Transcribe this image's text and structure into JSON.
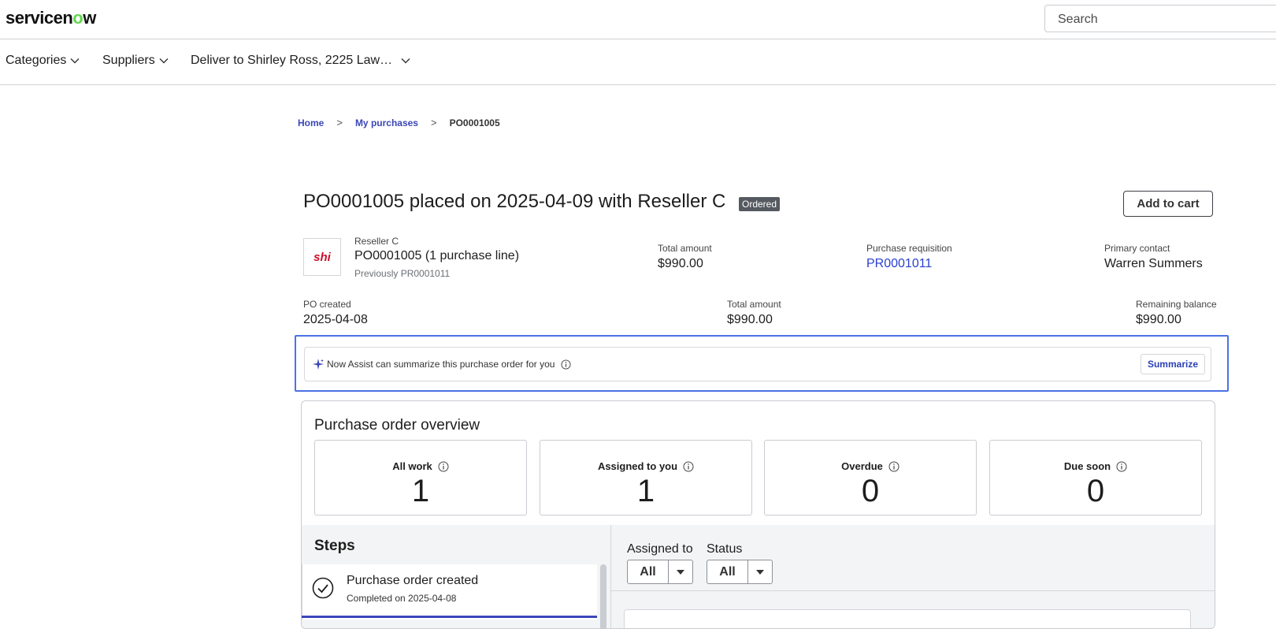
{
  "header": {
    "logo_pre": "servicen",
    "logo_o": "o",
    "logo_post": "w",
    "search_placeholder": "Search"
  },
  "nav": {
    "categories": "Categories",
    "suppliers": "Suppliers",
    "deliver_to": "Deliver to Shirley Ross, 2225 Law…"
  },
  "breadcrumb": {
    "home": "Home",
    "my_purchases": "My purchases",
    "current": "PO0001005"
  },
  "order": {
    "title": "PO0001005 placed on 2025-04-09 with Reseller C",
    "status_badge": "Ordered",
    "add_to_cart": "Add to cart",
    "supplier_logo_text": "shi",
    "supplier_name": "Reseller C",
    "po_line": "PO0001005 (1 purchase line)",
    "previously": "Previously PR0001011",
    "total_amount_label_1": "Total amount",
    "total_amount_value_1": "$990.00",
    "purchase_requisition_label": "Purchase requisition",
    "purchase_requisition_value": "PR0001011",
    "primary_contact_label": "Primary contact",
    "primary_contact_value": "Warren Summers",
    "po_created_label": "PO created",
    "po_created_value": "2025-04-08",
    "total_amount_label_2": "Total amount",
    "total_amount_value_2": "$990.00",
    "remaining_balance_label": "Remaining balance",
    "remaining_balance_value": "$990.00"
  },
  "assist": {
    "text": "Now Assist can summarize this purchase order for you",
    "button": "Summarize"
  },
  "overview": {
    "title": "Purchase order overview",
    "stats": [
      {
        "label": "All work",
        "value": "1"
      },
      {
        "label": "Assigned to you",
        "value": "1"
      },
      {
        "label": "Overdue",
        "value": "0"
      },
      {
        "label": "Due soon",
        "value": "0"
      }
    ],
    "steps_title": "Steps",
    "steps": [
      {
        "name": "Purchase order created",
        "date": "Completed on 2025-04-08"
      }
    ],
    "filters": {
      "assigned_to_label": "Assigned to",
      "assigned_to_value": "All",
      "status_label": "Status",
      "status_value": "All"
    }
  },
  "icons": {
    "chevron": "chevron-down-icon",
    "info": "info-icon",
    "sparkle": "sparkle-icon",
    "check": "check-circle-icon"
  },
  "colors": {
    "brand_green": "#62d84e",
    "link_blue": "#3a46b8",
    "highlight_border": "#4b72e6",
    "badge_bg": "#555a60"
  }
}
